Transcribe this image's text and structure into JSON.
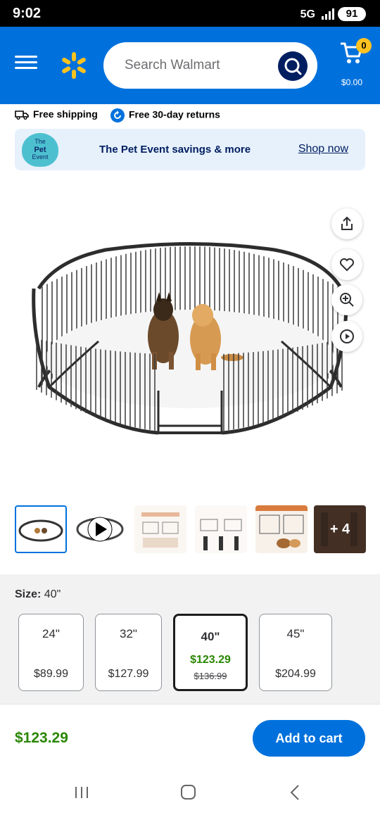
{
  "status_bar": {
    "time": "9:02",
    "network": "5G",
    "battery": "91"
  },
  "header": {
    "search_placeholder": "Search Walmart",
    "cart_count": "0",
    "cart_total": "$0.00"
  },
  "perks": {
    "shipping": "Free shipping",
    "returns": "Free 30-day returns"
  },
  "promo": {
    "logo_top": "The",
    "logo_main": "Pet",
    "logo_bottom": "Event",
    "text": "The Pet Event savings & more",
    "link": "Shop now"
  },
  "gallery": {
    "more_count": "+ 4",
    "icons": [
      "share-icon",
      "heart-icon",
      "zoom-in-icon",
      "play-icon"
    ]
  },
  "size": {
    "label": "Size:",
    "selected": "40\"",
    "options": [
      {
        "size": "24\"",
        "price": "$89.99"
      },
      {
        "size": "32\"",
        "price": "$127.99"
      },
      {
        "size": "40\"",
        "sale_price": "$123.29",
        "was_price": "$136.99"
      },
      {
        "size": "45\"",
        "price": "$204.99"
      }
    ]
  },
  "buy_bar": {
    "price": "$123.29",
    "add_to_cart": "Add to cart"
  },
  "colors": {
    "brand_blue": "#0071dc",
    "navy": "#001e60",
    "spark": "#ffc220",
    "sale_green": "#2a8703"
  }
}
